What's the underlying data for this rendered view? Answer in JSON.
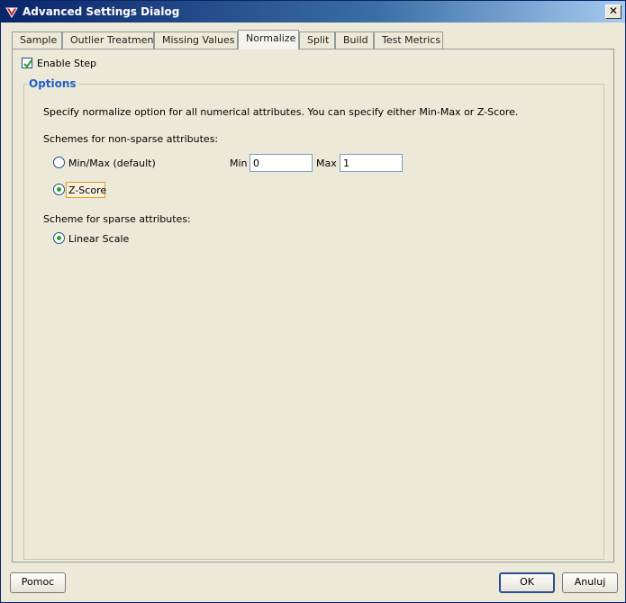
{
  "window": {
    "title": "Advanced Settings Dialog",
    "close_label": "✕"
  },
  "tabs": [
    {
      "label": "Sample",
      "active": false
    },
    {
      "label": "Outlier Treatment",
      "active": false
    },
    {
      "label": "Missing Values",
      "active": false
    },
    {
      "label": "Normalize",
      "active": true
    },
    {
      "label": "Split",
      "active": false
    },
    {
      "label": "Build",
      "active": false
    },
    {
      "label": "Test Metrics",
      "active": false
    }
  ],
  "enable_step": {
    "label": "Enable Step",
    "checked": true
  },
  "options": {
    "legend": "Options",
    "description": "Specify normalize option for all numerical attributes.  You can specify either Min-Max or Z-Score.",
    "non_sparse_label": "Schemes for non-sparse attributes:",
    "minmax_label": "Min/Max (default)",
    "zscore_label": "Z-Score",
    "min_label": "Min",
    "min_value": "0",
    "max_label": "Max",
    "max_value": "1",
    "sparse_label": "Scheme for sparse attributes:",
    "linear_label": "Linear Scale",
    "selected_non_sparse": "Z-Score",
    "selected_sparse": "Linear Scale"
  },
  "footer": {
    "help_label": "Pomoc",
    "ok_label": "OK",
    "cancel_label": "Anuluj"
  },
  "colors": {
    "legend_text": "#1e5fcc",
    "radio_selected": "#2f9e2f",
    "titlebar": "#0a246a"
  }
}
